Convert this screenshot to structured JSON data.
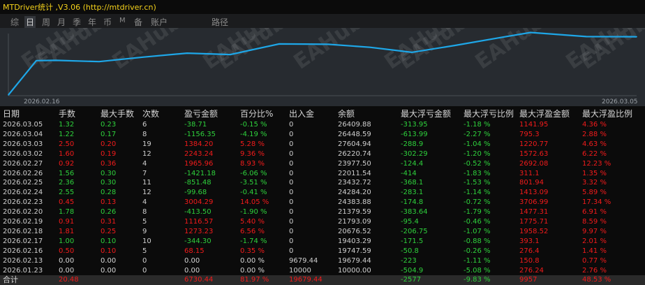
{
  "app": {
    "title": "MTDriver统计 ,V3.06 (http://mtdriver.cn)"
  },
  "tabs": [
    {
      "label": "综",
      "active": false
    },
    {
      "label": "日",
      "active": true
    },
    {
      "label": "周",
      "active": false
    },
    {
      "label": "月",
      "active": false
    },
    {
      "label": "季",
      "active": false
    },
    {
      "label": "年",
      "active": false
    },
    {
      "label": "币",
      "active": false
    },
    {
      "label": "M",
      "active": false
    },
    {
      "label": "备",
      "active": false
    },
    {
      "label": "账户",
      "active": false
    },
    {
      "label": "路径",
      "active": false
    }
  ],
  "chart_data": {
    "type": "line",
    "x": [
      "2026.01.23",
      "2026.02.13",
      "2026.02.16",
      "2026.02.17",
      "2026.02.18",
      "2026.02.19",
      "2026.02.20",
      "2026.02.23",
      "2026.02.24",
      "2026.02.25",
      "2026.02.26",
      "2026.02.27",
      "2026.03.02",
      "2026.03.03",
      "2026.03.04",
      "2026.03.05"
    ],
    "values": [
      10000.0,
      19679.44,
      19747.59,
      19403.29,
      20676.52,
      21793.09,
      21379.59,
      24383.88,
      24284.2,
      23432.72,
      22011.54,
      23977.5,
      26220.74,
      27604.94,
      26448.59,
      26409.88
    ],
    "xlabel_left": "2026.02.16",
    "xlabel_right": "2026.03.05",
    "line_color": "#1ea7e8",
    "watermark": "EAHub.cn"
  },
  "table": {
    "headers": [
      "日期",
      "手数",
      "最大手数",
      "次数",
      "盈亏金额",
      "百分比%",
      "出入金",
      "余额",
      "最大浮亏金额",
      "最大浮亏比例",
      "最大浮盈金额",
      "最大浮盈比例"
    ],
    "rows": [
      {
        "s": "neg",
        "c": [
          "2026.03.05",
          "1.32",
          "0.23",
          "6",
          "-38.71",
          "-0.15 %",
          "0",
          "26409.88",
          "-313.95",
          "-1.18 %",
          "1141.95",
          "4.36 %"
        ]
      },
      {
        "s": "neg",
        "c": [
          "2026.03.04",
          "1.22",
          "0.17",
          "8",
          "-1156.35",
          "-4.19 %",
          "0",
          "26448.59",
          "-613.99",
          "-2.27 %",
          "795.3",
          "2.88 %"
        ]
      },
      {
        "s": "pos",
        "c": [
          "2026.03.03",
          "2.50",
          "0.20",
          "19",
          "1384.20",
          "5.28 %",
          "0",
          "27604.94",
          "-288.9",
          "-1.04 %",
          "1220.77",
          "4.63 %"
        ]
      },
      {
        "s": "pos",
        "c": [
          "2026.03.02",
          "1.60",
          "0.19",
          "12",
          "2243.24",
          "9.36 %",
          "0",
          "26220.74",
          "-302.29",
          "-1.20 %",
          "1572.63",
          "6.22 %"
        ]
      },
      {
        "s": "pos",
        "c": [
          "2026.02.27",
          "0.92",
          "0.36",
          "4",
          "1965.96",
          "8.93 %",
          "0",
          "23977.50",
          "-124.4",
          "-0.52 %",
          "2692.08",
          "12.23 %"
        ]
      },
      {
        "s": "neg",
        "c": [
          "2026.02.26",
          "1.56",
          "0.30",
          "7",
          "-1421.18",
          "-6.06 %",
          "0",
          "22011.54",
          "-414",
          "-1.83 %",
          "311.1",
          "1.35 %"
        ]
      },
      {
        "s": "neg",
        "c": [
          "2026.02.25",
          "2.36",
          "0.30",
          "11",
          "-851.48",
          "-3.51 %",
          "0",
          "23432.72",
          "-368.1",
          "-1.53 %",
          "801.94",
          "3.32 %"
        ]
      },
      {
        "s": "neg",
        "c": [
          "2026.02.24",
          "2.55",
          "0.28",
          "12",
          "-99.68",
          "-0.41 %",
          "0",
          "24284.20",
          "-283.1",
          "-1.14 %",
          "1413.09",
          "5.89 %"
        ]
      },
      {
        "s": "pos",
        "c": [
          "2026.02.23",
          "0.45",
          "0.13",
          "4",
          "3004.29",
          "14.05 %",
          "0",
          "24383.88",
          "-174.8",
          "-0.72 %",
          "3706.99",
          "17.34 %"
        ]
      },
      {
        "s": "neg",
        "c": [
          "2026.02.20",
          "1.78",
          "0.26",
          "8",
          "-413.50",
          "-1.90 %",
          "0",
          "21379.59",
          "-383.64",
          "-1.79 %",
          "1477.31",
          "6.91 %"
        ]
      },
      {
        "s": "pos",
        "c": [
          "2026.02.19",
          "0.91",
          "0.31",
          "5",
          "1116.57",
          "5.40 %",
          "0",
          "21793.09",
          "-95.4",
          "-0.46 %",
          "1775.71",
          "8.59 %"
        ]
      },
      {
        "s": "pos",
        "c": [
          "2026.02.18",
          "1.81",
          "0.25",
          "9",
          "1273.23",
          "6.56 %",
          "0",
          "20676.52",
          "-206.75",
          "-1.07 %",
          "1958.52",
          "9.97 %"
        ]
      },
      {
        "s": "neg",
        "c": [
          "2026.02.17",
          "1.00",
          "0.10",
          "10",
          "-344.30",
          "-1.74 %",
          "0",
          "19403.29",
          "-171.5",
          "-0.88 %",
          "393.1",
          "2.01 %"
        ]
      },
      {
        "s": "pos",
        "c": [
          "2026.02.16",
          "0.50",
          "0.10",
          "5",
          "68.15",
          "0.35 %",
          "0",
          "19747.59",
          "-50.8",
          "-0.26 %",
          "276.4",
          "1.41 %"
        ]
      },
      {
        "s": "zero",
        "c": [
          "2026.02.13",
          "0.00",
          "0.00",
          "0",
          "0.00",
          "0.00 %",
          "9679.44",
          "19679.44",
          "-223",
          "-1.11 %",
          "150.8",
          "0.77 %"
        ]
      },
      {
        "s": "zero",
        "c": [
          "2026.01.23",
          "0.00",
          "0.00",
          "0",
          "0.00",
          "0.00 %",
          "10000",
          "10000.00",
          "-504.9",
          "-5.08 %",
          "276.24",
          "2.76 %"
        ]
      }
    ],
    "total": [
      "合计",
      "20.48",
      "",
      "",
      "6730.44",
      "81.97 %",
      "19679.44",
      "",
      "-2577",
      "-9.83 %",
      "9957",
      "48.53 %"
    ]
  }
}
